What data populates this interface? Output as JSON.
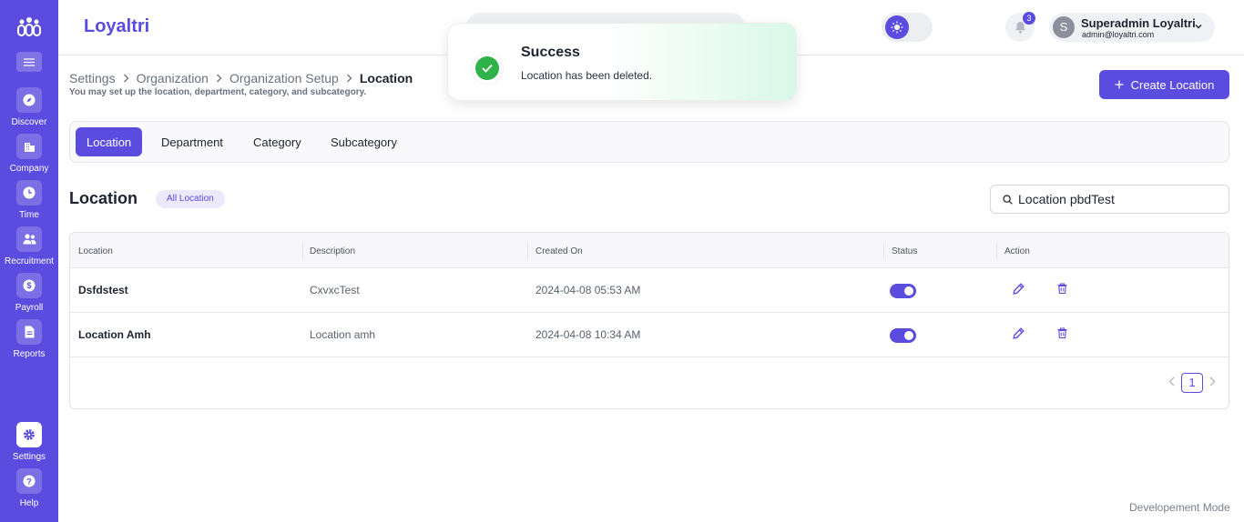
{
  "app": {
    "brand": "Loyaltri"
  },
  "sidebar": {
    "items": [
      {
        "label": "Discover",
        "icon": "compass-icon"
      },
      {
        "label": "Company",
        "icon": "building-icon"
      },
      {
        "label": "Time",
        "icon": "clock-icon"
      },
      {
        "label": "Recruitment",
        "icon": "users-icon"
      },
      {
        "label": "Payroll",
        "icon": "dollar-icon"
      },
      {
        "label": "Reports",
        "icon": "document-icon"
      }
    ],
    "bottom": [
      {
        "label": "Settings",
        "icon": "gear-icon",
        "active": true
      },
      {
        "label": "Help",
        "icon": "question-icon"
      }
    ]
  },
  "header": {
    "notification_count": "3",
    "user": {
      "initial": "S",
      "name": "Superadmin Loyaltri",
      "email": "admin@loyaltri.com"
    }
  },
  "breadcrumb": [
    "Settings",
    "Organization",
    "Organization Setup",
    "Location"
  ],
  "subtitle": "You may set up the location, department, category, and subcategory.",
  "create_button": "Create Location",
  "tabs": [
    {
      "label": "Location",
      "active": true
    },
    {
      "label": "Department"
    },
    {
      "label": "Category"
    },
    {
      "label": "Subcategory"
    }
  ],
  "section": {
    "title": "Location",
    "badge": "All Location"
  },
  "search": {
    "value": "Location pbdTest"
  },
  "table": {
    "columns": [
      "Location",
      "Description",
      "Created On",
      "Status",
      "Action"
    ],
    "rows": [
      {
        "location": "Dsfdstest",
        "description": "CxvxcTest",
        "created_on": "2024-04-08 05:53 AM",
        "status": true
      },
      {
        "location": "Location Amh",
        "description": "Location amh",
        "created_on": "2024-04-08 10:34 AM",
        "status": true
      }
    ]
  },
  "pagination": {
    "current": "1"
  },
  "toast": {
    "title": "Success",
    "message": "Location has been deleted."
  },
  "footer": {
    "mode": "Developement Mode"
  },
  "colors": {
    "primary": "#5b4ce0",
    "success": "#2fb24a"
  }
}
